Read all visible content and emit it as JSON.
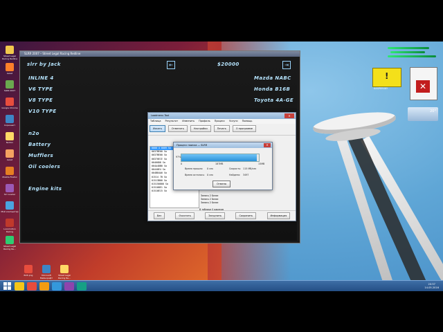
{
  "game": {
    "window_title": "SLRR 2007 – Street Legal Racing Redline",
    "player": "slrr by Jack",
    "money": "$20000",
    "left_menu": [
      "INLINE 4",
      "V6 TYPE",
      "V8 TYPE",
      "V10 TYPE",
      "n2o",
      "Battery",
      "Mufflers",
      "Oil coolers",
      "Engine kits"
    ],
    "right_menu": [
      "Mazda NABC",
      "Honda B16B",
      "Toyota 4A-GE"
    ]
  },
  "tool": {
    "title": "Loadmenu Tool",
    "menu": [
      "Таблица",
      "Результат",
      "Изменить",
      "Профиль",
      "Процесс",
      "Услуги",
      "Помощь"
    ],
    "toolbar": [
      "Искать",
      "Отметить",
      "Настройки",
      "Печать",
      "О программе"
    ],
    "list_items": [
      "0000 4 0009 Sa",
      "0037BE00 Sa",
      "0037BE00 Sa",
      "00370ECE Sa",
      "00460D8 Sa",
      "004A48B0 Sa",
      "00440E4 Sa",
      "004B84A0 Sa",
      "01514 7B Sa",
      "01513B00 Sa",
      "015150800 Sa",
      "015108E1 Sa",
      "01510E15 Sa"
    ],
    "list_right": [
      "Запись 2 Базис",
      "Запись 2 Базис",
      "Запись 2 Базис"
    ],
    "status": "В таблице 0 адресов",
    "bottom_buttons": [
      "Без",
      "Очистить",
      "Загрузить",
      "Сохранить",
      "Информация"
    ]
  },
  "progress": {
    "title": "Процесс поиска — SLRR",
    "percent": 97,
    "left_label": "0",
    "mid_label": "187MB",
    "right_label": "15MB",
    "elapsed_label": "Время прошло:",
    "elapsed_value": "0 сек",
    "remaining_label": "Время осталось:",
    "remaining_value": "0 сек",
    "speed_label": "Скорость:",
    "speed_value": "115 MB/сек",
    "found_label": "Найдено:",
    "found_value": "3497",
    "cancel": "Отмена"
  },
  "desktop": {
    "left_icons": [
      "Street Legal Racing Redline",
      "Avast",
      "SLRR 2007",
      "Google Chrome",
      "Скриншот",
      "Norton",
      "Avast",
      "Mozilla Firefox",
      "Slrr Loader",
      "Мой компьютер",
      "Locomotion Racing",
      "Street Legal Racing Re..."
    ],
    "bottom_icons": [
      "БСК.png",
      "Microsoft Майнкрафт",
      "Street Legal Racing Re..."
    ],
    "kaspersky_label": "KASPERSKY",
    "weather_temp": "20°"
  },
  "taskbar": {
    "time": "20:57",
    "date": "14.05.2016",
    "apps": [
      "explorer",
      "chrome",
      "firefox",
      "ie",
      "game",
      "tool"
    ]
  },
  "colors": {
    "game_text": "#b7e5ff",
    "progress": "#2a91d8",
    "taskbar": "#2f5d96"
  }
}
